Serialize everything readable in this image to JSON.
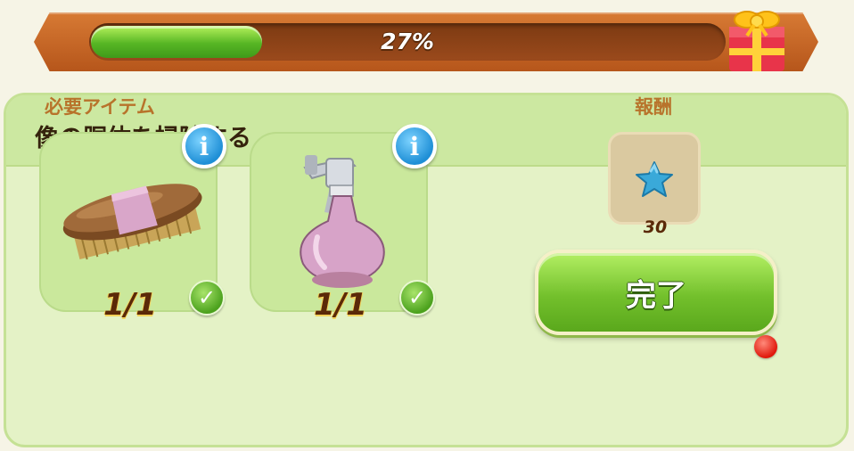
{
  "progress": {
    "percent": 27,
    "label": "27%"
  },
  "gift": {
    "icon": "gift-box-icon"
  },
  "task": {
    "title": "像の胴体を掃除する"
  },
  "requirements": {
    "label": "必要アイテム",
    "items": [
      {
        "icon": "scrub-brush-icon",
        "count": "1/1",
        "completed": true
      },
      {
        "icon": "spray-bottle-icon",
        "count": "1/1",
        "completed": true
      }
    ]
  },
  "reward": {
    "label": "報酬",
    "icon": "blue-star-icon",
    "amount": "30"
  },
  "complete_button": {
    "label": "完了",
    "has_notification": true
  },
  "colors": {
    "panel_bg": "#e4f2c6",
    "header_bg": "#cce8a1",
    "progress_fill": "#57b624",
    "frame": "#c6662a",
    "label_orange": "#b8732b"
  }
}
